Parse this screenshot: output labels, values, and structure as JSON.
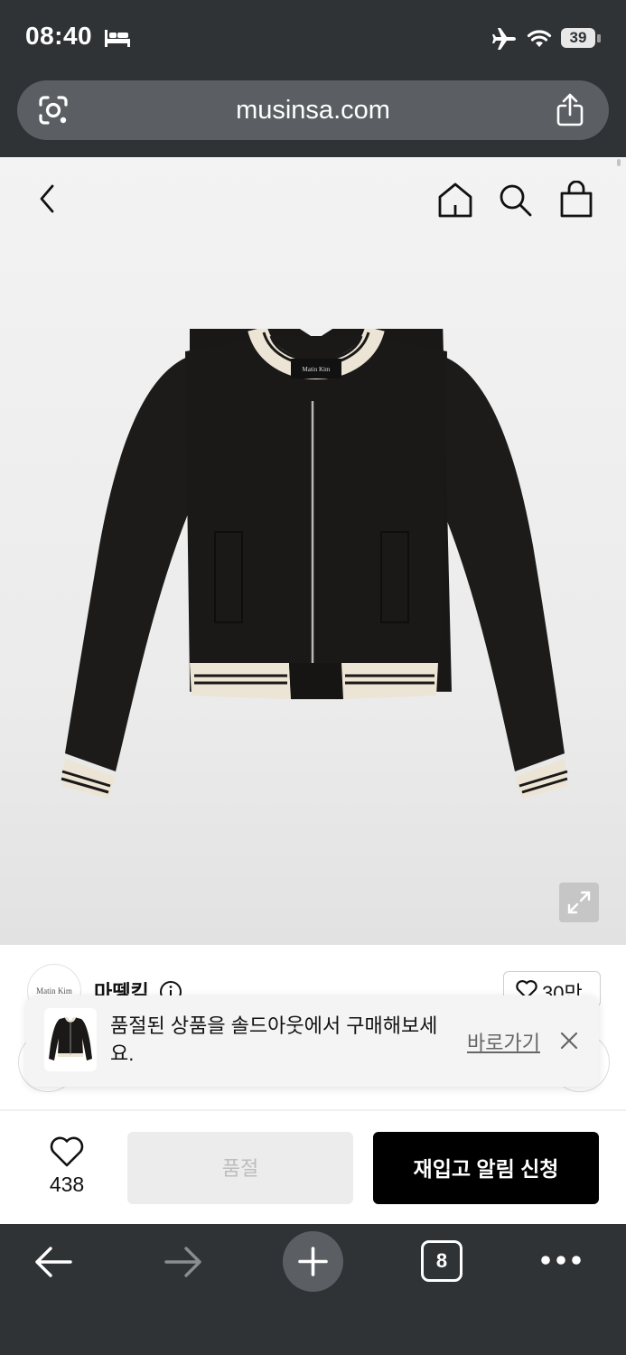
{
  "status_bar": {
    "time": "08:40",
    "battery": "39",
    "icons": [
      "bed-icon",
      "airplane-icon",
      "wifi-icon",
      "battery-icon"
    ]
  },
  "browser": {
    "url": "musinsa.com",
    "tab_count": "8",
    "icons": [
      "google-lens-icon",
      "share-icon",
      "back-icon",
      "forward-icon",
      "new-tab-icon",
      "tabs-icon",
      "more-icon"
    ]
  },
  "product_header": {
    "icons": [
      "back-chevron-icon",
      "home-icon",
      "search-icon",
      "shopping-bag-icon"
    ]
  },
  "product_image": {
    "brand_label": "Matin Kim",
    "icons": [
      "expand-icon"
    ]
  },
  "brand": {
    "logo_text": "Matin Kim",
    "name": "마뗑킴",
    "likes": "30만"
  },
  "toast": {
    "message": "품절된 상품을 솔드아웃에서 구매해보세요.",
    "link": "바로가기"
  },
  "bottom_bar": {
    "like_count": "438",
    "soldout_label": "품절",
    "restock_label": "재입고 알림 신청"
  },
  "colors": {
    "chrome_bg": "#303336",
    "url_bar_bg": "#5b5f63",
    "primary_button": "#000000",
    "disabled_button": "#ececec"
  }
}
